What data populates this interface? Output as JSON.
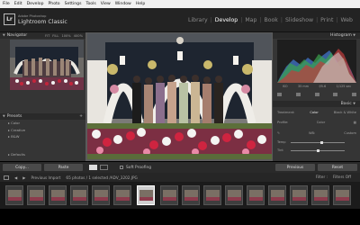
{
  "os_menu": [
    "File",
    "Edit",
    "Develop",
    "Photo",
    "Settings",
    "Tools",
    "View",
    "Window",
    "Help"
  ],
  "app": {
    "logo": "Lr",
    "brand_top": "Adobe Photoshop",
    "brand": "Lightroom Classic",
    "modules": [
      "Library",
      "Develop",
      "Map",
      "Book",
      "Slideshow",
      "Print",
      "Web"
    ],
    "active_module": "Develop"
  },
  "navigator": {
    "title": "Navigator",
    "zoom_options": [
      "FIT",
      "FILL",
      "100%",
      "400%"
    ]
  },
  "presets": {
    "title": "Presets",
    "items": [
      "Color",
      "Creative",
      "B&W"
    ],
    "add_label": "+"
  },
  "bottom_group": "Defaults",
  "left_buttons": {
    "copy": "Copy...",
    "paste": "Paste"
  },
  "toolbar": {
    "soft_proofing": "Soft Proofing"
  },
  "histogram": {
    "title": "Histogram",
    "info": [
      "ISO",
      "35 mm",
      "f/5.6",
      "1/125 sec"
    ],
    "original_photo": "Original Photo"
  },
  "basic": {
    "title": "Basic",
    "treatment_label": "Treatment:",
    "color": "Color",
    "bw": "Black & White",
    "profile_label": "Profile:",
    "profile_value": "Color",
    "wb_label": "WB:",
    "wb_value": "Custom",
    "temp_label": "Temp",
    "tint_label": "Tint"
  },
  "right_buttons": {
    "previous": "Previous",
    "reset": "Reset"
  },
  "filmstrip_bar": {
    "previous_import": "Previous Import",
    "status": "65 photos / 1 selected /ADV_3202.JPG",
    "filter_label": "Filter :",
    "filter_value": "Filters Off"
  },
  "colors": {
    "panel": "#353535",
    "header": "#232323",
    "active": "#ffffff",
    "bg": "#5b5b5b"
  }
}
